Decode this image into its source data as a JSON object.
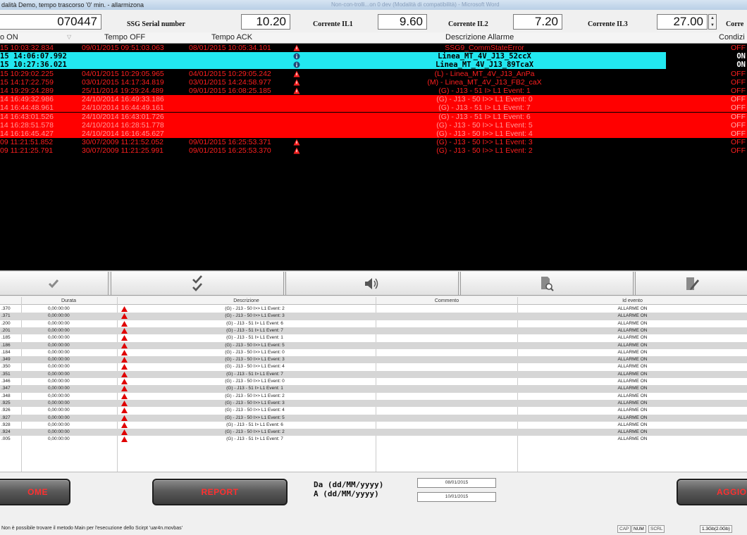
{
  "window": {
    "title": "dalità Demo, tempo trascorso '0' min. - allarmizona",
    "ghost_text": "Non-con-trolli...on 0 dev (Modalità di compatibilità) - Microsoft Word"
  },
  "top_values": {
    "serial_value": "070447",
    "serial_label": "SSG Serial number",
    "il1_value": "10.20",
    "il1_label": "Corrente IL1",
    "il2_value": "9.60",
    "il2_label": "Corrente IL2",
    "il3_value": "7.20",
    "il3_label": "Corrente IL3",
    "extra_value": "27.00",
    "extra_label": "Corre"
  },
  "alarm_table": {
    "headers": {
      "on": "o ON",
      "off": "Tempo OFF",
      "ack": "Tempo ACK",
      "desc": "Descrizione Allarme",
      "cond": "Condizi"
    },
    "rows": [
      {
        "style": "black",
        "icon": "alarm",
        "on": "15 10:03:32.834",
        "off": "09/01/2015 09:51:03.063",
        "ack": "08/01/2015 10:05:34.101",
        "desc": "SSG9_CommStateError",
        "state": "OFF"
      },
      {
        "style": "cyan",
        "icon": "info",
        "on": "15 14:06:07.992",
        "off": "",
        "ack": "",
        "desc": "Linea_MT_4V_J13_52ccX",
        "state": "ON"
      },
      {
        "style": "cyan",
        "icon": "info",
        "on": "15 10:27:36.021",
        "off": "",
        "ack": "",
        "desc": "Linea_MT_4V_J13_89TcaX",
        "state": "ON"
      },
      {
        "style": "black",
        "icon": "alarm",
        "on": "15 10:29:02.225",
        "off": "04/01/2015 10:29:05.965",
        "ack": "04/01/2015 10:29:05.242",
        "desc": "(L) - Linea_MT_4V_J13_AnPa",
        "state": "OFF"
      },
      {
        "style": "black",
        "icon": "alarm",
        "on": "15 14:17:22.759",
        "off": "03/01/2015 14:17:34.819",
        "ack": "03/01/2015 14:24:58.977",
        "desc": "(M) - Linea_MT_4V_J13_FB2_caX",
        "state": "OFF"
      },
      {
        "style": "black",
        "icon": "alarm",
        "on": "14 19:29:24.289",
        "off": "25/11/2014 19:29:24.489",
        "ack": "09/01/2015 16:08:25.185",
        "desc": "(G) - J13 - 51 I> L1  Event: 1",
        "state": "OFF"
      },
      {
        "style": "red",
        "icon": "",
        "on": "14 16:49:32.986",
        "off": "24/10/2014 16:49:33.186",
        "ack": "",
        "desc": "(G) - J13 - 50 I>> L1  Event: 0",
        "state": "OFF"
      },
      {
        "style": "red",
        "icon": "",
        "on": "14 16:44:48.961",
        "off": "24/10/2014 16:44:49.161",
        "ack": "",
        "desc": "(G) - J13 - 51 I> L1  Event: 7",
        "state": "OFF"
      },
      {
        "style": "red",
        "icon": "",
        "on": "14 16:43:01.526",
        "off": "24/10/2014 16:43:01.726",
        "ack": "",
        "desc": "(G) - J13 - 51 I> L1  Event: 6",
        "state": "OFF"
      },
      {
        "style": "red",
        "icon": "",
        "on": "14 16:28:51.578",
        "off": "24/10/2014 16:28:51.778",
        "ack": "",
        "desc": "(G) - J13 - 50 I>> L1  Event: 5",
        "state": "OFF"
      },
      {
        "style": "red",
        "icon": "",
        "on": "14 16:16:45.427",
        "off": "24/10/2014 16:16:45.627",
        "ack": "",
        "desc": "(G) - J13 - 50 I>> L1  Event: 4",
        "state": "OFF"
      },
      {
        "style": "black",
        "icon": "alarm",
        "on": "09 11:21:51.852",
        "off": "30/07/2009 11:21:52.052",
        "ack": "09/01/2015 16:25:53.371",
        "desc": "(G) - J13 - 50 I>> L1  Event: 3",
        "state": "OFF"
      },
      {
        "style": "black",
        "icon": "alarm",
        "on": "09 11:21:25.791",
        "off": "30/07/2009 11:21:25.991",
        "ack": "09/01/2015 16:25:53.370",
        "desc": "(G) - J13 - 50 I>> L1  Event: 2",
        "state": "OFF"
      }
    ]
  },
  "toolbar": {
    "icons": [
      "check-icon",
      "double-check-icon",
      "speaker-icon",
      "document-search-icon",
      "edit-document-icon"
    ]
  },
  "event_table": {
    "headers": {
      "durata": "Durata",
      "descrizione": "Descrizione",
      "commento": "Commento",
      "id": "Id evento"
    },
    "rows": [
      {
        "t": ".370",
        "dur": "0,00:00:00",
        "desc": "(G) - J13 - 50 I>> L1  Event: 2",
        "id": "ALLARME ON"
      },
      {
        "t": ".371",
        "dur": "0,00:00:00",
        "desc": "(G) - J13 - 50 I>> L1  Event: 3",
        "id": "ALLARME ON"
      },
      {
        "t": ".200",
        "dur": "0,00:00:00",
        "desc": "(G) - J13 - 51 I> L1  Event: 6",
        "id": "ALLARME ON"
      },
      {
        "t": ".201",
        "dur": "0,00:00:00",
        "desc": "(G) - J13 - 51 I> L1  Event: 7",
        "id": "ALLARME ON"
      },
      {
        "t": ".185",
        "dur": "0,00:00:00",
        "desc": "(G) - J13 - 51 I> L1  Event: 1",
        "id": "ALLARME ON"
      },
      {
        "t": ".186",
        "dur": "0,00:00:00",
        "desc": "(G) - J13 - 50 I>> L1  Event: 5",
        "id": "ALLARME ON"
      },
      {
        "t": ".184",
        "dur": "0,00:00:00",
        "desc": "(G) - J13 - 50 I>> L1  Event: 0",
        "id": "ALLARME ON"
      },
      {
        "t": ".349",
        "dur": "0,00:00:00",
        "desc": "(G) - J13 - 50 I>> L1  Event: 3",
        "id": "ALLARME ON"
      },
      {
        "t": ".350",
        "dur": "0,00:00:00",
        "desc": "(G) - J13 - 50 I>> L1  Event: 4",
        "id": "ALLARME ON"
      },
      {
        "t": ".351",
        "dur": "0,00:00:00",
        "desc": "(G) - J13 - 51 I> L1  Event: 7",
        "id": "ALLARME ON"
      },
      {
        "t": ".346",
        "dur": "0,00:00:00",
        "desc": "(G) - J13 - 50 I>> L1  Event: 0",
        "id": "ALLARME ON"
      },
      {
        "t": ".347",
        "dur": "0,00:00:00",
        "desc": "(G) - J13 - 51 I> L1  Event: 1",
        "id": "ALLARME ON"
      },
      {
        "t": ".348",
        "dur": "0,00:00:00",
        "desc": "(G) - J13 - 50 I>> L1  Event: 2",
        "id": "ALLARME ON"
      },
      {
        "t": ".925",
        "dur": "0,00:00:00",
        "desc": "(G) - J13 - 50 I>> L1  Event: 3",
        "id": "ALLARME ON"
      },
      {
        "t": ".926",
        "dur": "0,00:00:00",
        "desc": "(G) - J13 - 50 I>> L1  Event: 4",
        "id": "ALLARME ON"
      },
      {
        "t": ".927",
        "dur": "0,00:00:00",
        "desc": "(G) - J13 - 50 I>> L1  Event: 5",
        "id": "ALLARME ON"
      },
      {
        "t": ".928",
        "dur": "0,00:00:00",
        "desc": "(G) - J13 - 51 I> L1  Event: 6",
        "id": "ALLARME ON"
      },
      {
        "t": ".924",
        "dur": "0,00:00:00",
        "desc": "(G) - J13 - 50 I>> L1  Event: 2",
        "id": "ALLARME ON"
      },
      {
        "t": ".005",
        "dur": "0,00:00:00",
        "desc": "(G) - J13 - 51 I> L1  Event: 7",
        "id": "ALLARME ON"
      }
    ]
  },
  "bottom": {
    "home_label": "OME",
    "report_label": "REPORT",
    "from_label": "Da (dd/MM/yyyy)",
    "to_label": "A  (dd/MM/yyyy)",
    "from_date": "08/01/2015",
    "to_date": "10/01/2015",
    "update_label": "AGGIO"
  },
  "statusbar": {
    "message": "Non è possibile trovare il metodo Main per l'esecuzione dello Scirpt 'uar4n.movbas'",
    "cap": "CAP",
    "num": "NUM",
    "scrl": "SCRL",
    "memory": "1.3Gb(2.0Gb)"
  },
  "colors": {
    "alarm_black_bg": "#000000",
    "alarm_red_bg": "#ff0000",
    "alarm_cyan_bg": "#22e8f0",
    "alarm_text_red": "#ff1f1f",
    "button_text": "#ff3030"
  }
}
